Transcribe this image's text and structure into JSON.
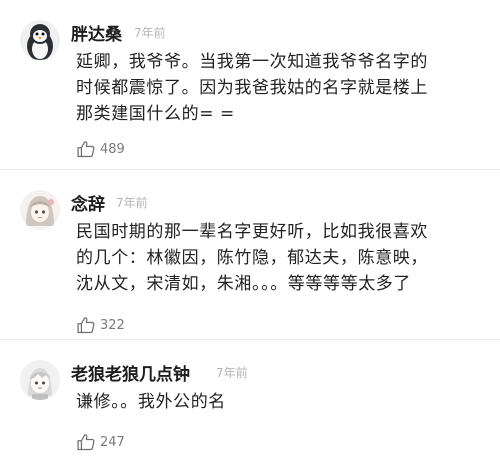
{
  "comments": [
    {
      "author": "胖达桑",
      "time": "7年前",
      "avatar_icon": "penguin-avatar-icon",
      "lines": [
        "延卿，我爷爷。当我第一次知道我爷爷名字的",
        "时候都震惊了。因为我爸我姑的名字就是楼上",
        "那类建国什么的= ="
      ],
      "likes": "489"
    },
    {
      "author": "念辞",
      "time": "7年前",
      "avatar_icon": "anime-girl-avatar-icon",
      "lines": [
        "民国时期的那一辈名字更好听，比如我很喜欢",
        "的几个：林徽因，陈竹隐，郁达夫，陈意映，",
        "沈从文，宋清如，朱湘。。。等等等等太多了"
      ],
      "likes": "322"
    },
    {
      "author": "老狼老狼几点钟",
      "time": "7年前",
      "avatar_icon": "anime-boy-avatar-icon",
      "lines": [
        "谦修。。我外公的名"
      ],
      "likes": "247"
    }
  ],
  "like_icon": "thumbs-up-icon"
}
